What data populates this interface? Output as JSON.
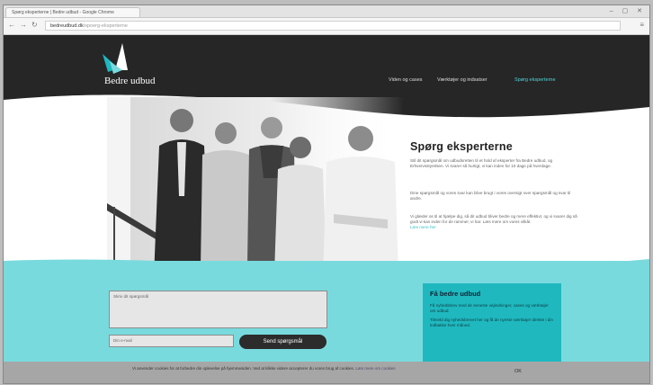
{
  "browser": {
    "tab_title": "Spørg eksperterne | Bedre udbud - Google Chrome",
    "window_controls": "–  ▢  ✕",
    "url_host": "bedreudbud.dk",
    "url_path": "/spoerg-eksperterne",
    "nav_icons": [
      "back-icon",
      "forward-icon",
      "reload-icon"
    ],
    "menu_icon": "menu-icon"
  },
  "site": {
    "logo_text": "Bedre udbud",
    "nav": [
      {
        "label": "Viden og cases",
        "active": false
      },
      {
        "label": "Værktøjer og indsatser",
        "active": false
      },
      {
        "label": "Spørg eksperterne",
        "active": true
      }
    ]
  },
  "hero": {
    "title": "Spørg eksperterne",
    "paragraphs": [
      "Stil dit spørgsmål om udbudsretten til et hold af eksperter fra Bedre udbud, og Erhvervsstyrelsen. Vi svarer så hurtigt, vi kan inden for 10 dage på hverdage.",
      "Dine spørgsmål og vores svar kan blive brugt i vores oversigt over spørgsmål og svar til andre.",
      "Vi glæder os til at hjælpe dig, så dit udbud bliver bedre og mere effektivt, og vi svarer dig så godt vi kan inden for de rammer, vi har. Læs mere om vores vilkår."
    ],
    "link": "Læs mere her"
  },
  "form": {
    "question_placeholder": "Skriv dit spørgsmål",
    "email_placeholder": "Din e-mail",
    "submit_label": "Send spørgsmål"
  },
  "newsletter": {
    "title": "Få bedre udbud",
    "paragraphs": [
      "Få nyhedsbrev med de seneste vejledninger, cases og værktøjer om udbud.",
      "Tilmeld dig nyhedsbrevet her og få de nyeste værktøjer direkte i din indbakke hver måned."
    ]
  },
  "cookie": {
    "text": "Vi anvender cookies for at forbedre din oplevelse på hjemmesiden. Ved at klikke videre accepterer du vores brug af cookies.",
    "link": "Læs mere om cookies",
    "ok_label": "OK"
  },
  "colors": {
    "header_bg": "#262626",
    "accent": "#4fd6d9",
    "teal_band": "#79dade",
    "newsbox": "#1fb8bf"
  }
}
